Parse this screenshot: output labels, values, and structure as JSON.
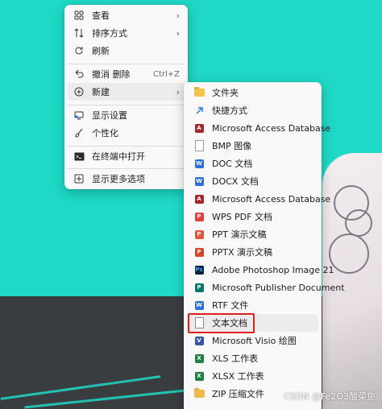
{
  "context_menu": {
    "items": [
      {
        "label": "查看",
        "icon": "grid-icon",
        "submenu": true
      },
      {
        "label": "排序方式",
        "icon": "sort-icon",
        "submenu": true
      },
      {
        "label": "刷新",
        "icon": "refresh-icon"
      },
      {
        "label": "撤消 删除",
        "icon": "undo-icon",
        "shortcut": "Ctrl+Z"
      },
      {
        "label": "新建",
        "icon": "new-icon",
        "submenu": true,
        "active": true
      },
      {
        "label": "显示设置",
        "icon": "display-icon"
      },
      {
        "label": "个性化",
        "icon": "brush-icon"
      },
      {
        "label": "在终端中打开",
        "icon": "terminal-icon"
      },
      {
        "label": "显示更多选项",
        "icon": "more-options-icon"
      }
    ]
  },
  "new_submenu": {
    "items": [
      {
        "label": "文件夹",
        "icon": "folder-icon"
      },
      {
        "label": "快捷方式",
        "icon": "shortcut-icon"
      },
      {
        "label": "Microsoft Access Database",
        "icon": "access-icon"
      },
      {
        "label": "BMP 图像",
        "icon": "bmp-icon"
      },
      {
        "label": "DOC 文档",
        "icon": "doc-icon"
      },
      {
        "label": "DOCX 文档",
        "icon": "docx-icon"
      },
      {
        "label": "Microsoft Access Database",
        "icon": "access-icon"
      },
      {
        "label": "WPS PDF 文档",
        "icon": "pdf-icon"
      },
      {
        "label": "PPT 演示文稿",
        "icon": "ppt-icon"
      },
      {
        "label": "PPTX 演示文稿",
        "icon": "pptx-icon"
      },
      {
        "label": "Adobe Photoshop Image 21",
        "icon": "photoshop-icon"
      },
      {
        "label": "Microsoft Publisher Document",
        "icon": "publisher-icon"
      },
      {
        "label": "RTF 文件",
        "icon": "rtf-icon"
      },
      {
        "label": "文本文档",
        "icon": "text-document-icon",
        "highlighted": true
      },
      {
        "label": "Microsoft Visio 绘图",
        "icon": "visio-icon"
      },
      {
        "label": "XLS 工作表",
        "icon": "xls-icon"
      },
      {
        "label": "XLSX 工作表",
        "icon": "xlsx-icon"
      },
      {
        "label": "ZIP 压缩文件",
        "icon": "zip-icon"
      }
    ]
  },
  "watermark": "CSDN @Fe2O3酸菜鱼",
  "colors": {
    "desktop_background": "#1fd8c6",
    "highlight_border": "#e02020",
    "menu_background": "#f9f9f9"
  }
}
